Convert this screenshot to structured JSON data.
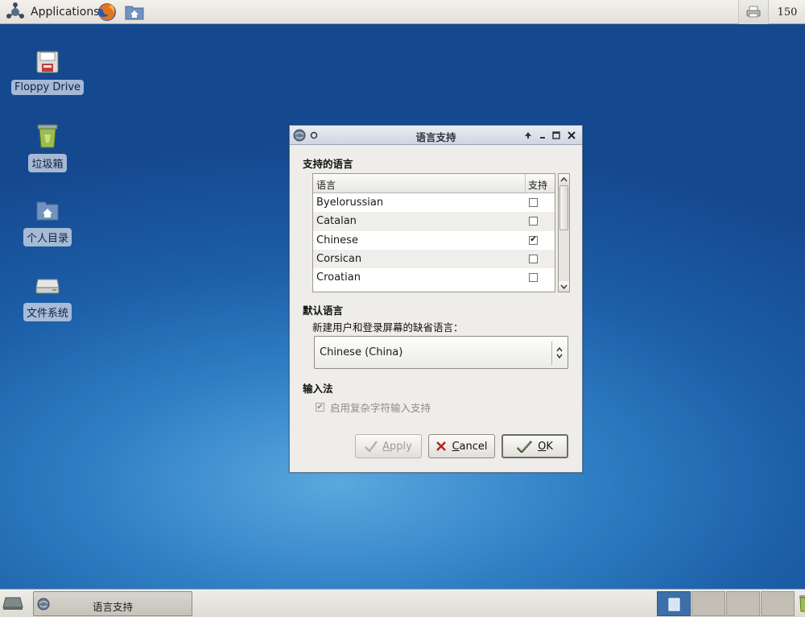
{
  "top_panel": {
    "applications_label": "Applications",
    "clock_text": "150"
  },
  "desktop": {
    "icons": [
      {
        "label": "Floppy Drive",
        "icon": "floppy-icon"
      },
      {
        "label": "垃圾箱",
        "icon": "trash-icon"
      },
      {
        "label": "个人目录",
        "icon": "home-folder-icon"
      },
      {
        "label": "文件系统",
        "icon": "drive-icon"
      }
    ]
  },
  "dialog": {
    "title": "语言支持",
    "supported_section": "支持的语言",
    "columns": {
      "language": "语言",
      "support": "支持"
    },
    "languages": [
      {
        "name": "Byelorussian",
        "supported": false
      },
      {
        "name": "Catalan",
        "supported": false
      },
      {
        "name": "Chinese",
        "supported": true
      },
      {
        "name": "Corsican",
        "supported": false
      },
      {
        "name": "Croatian",
        "supported": false
      }
    ],
    "default_section": "默认语言",
    "default_label": "新建用户和登录屏幕的缺省语言：",
    "default_value": "Chinese (China)",
    "input_section": "输入法",
    "input_checkbox_label": "启用复杂字符输入支持",
    "input_checkbox_checked": true,
    "buttons": {
      "apply": "Apply",
      "cancel": "Cancel",
      "ok": "OK"
    },
    "button_mnemonics": {
      "apply_first": "A",
      "apply_rest": "pply",
      "cancel_first": "C",
      "cancel_rest": "ancel",
      "ok_first": "O",
      "ok_rest": "K"
    }
  },
  "taskbar": {
    "tasks": [
      {
        "label": "语言支持"
      }
    ],
    "workspaces": 4,
    "active_workspace": 1
  },
  "colors": {
    "desktop_blue": "#1c5ea8",
    "active_workspace": "#3d6fa8"
  }
}
